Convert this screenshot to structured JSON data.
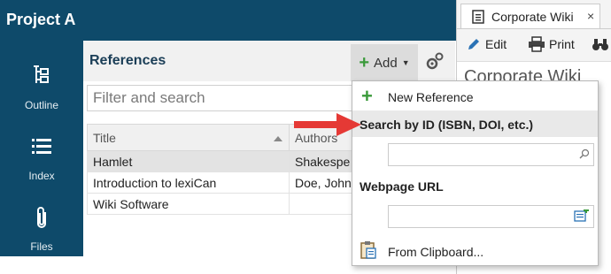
{
  "project": {
    "title": "Project A"
  },
  "nav": [
    {
      "label": "Outline",
      "icon": "outline-icon"
    },
    {
      "label": "Index",
      "icon": "list-icon"
    },
    {
      "label": "Files",
      "icon": "paperclip-icon"
    }
  ],
  "references": {
    "title": "References",
    "add_label": "Add",
    "search_placeholder": "Filter and search",
    "columns": [
      "Title",
      "Authors"
    ],
    "rows": [
      {
        "title": "Hamlet",
        "authors": "Shakespe",
        "selected": true
      },
      {
        "title": "Introduction to lexiCan",
        "authors": "Doe, John",
        "selected": false
      },
      {
        "title": "Wiki Software",
        "authors": "",
        "selected": false
      }
    ]
  },
  "wiki": {
    "tab_label": "Corporate Wiki",
    "close_label": "×",
    "edit_label": "Edit",
    "print_label": "Print",
    "heading": "Corporate Wiki"
  },
  "dropdown": {
    "new_reference": "New Reference",
    "search_by_id": "Search by ID (ISBN, DOI, etc.)",
    "webpage_url": "Webpage URL",
    "from_clipboard": "From Clipboard..."
  },
  "colors": {
    "sidebar": "#0e4a6a",
    "accent_green": "#3a9a3a",
    "arrow_red": "#e53935"
  }
}
